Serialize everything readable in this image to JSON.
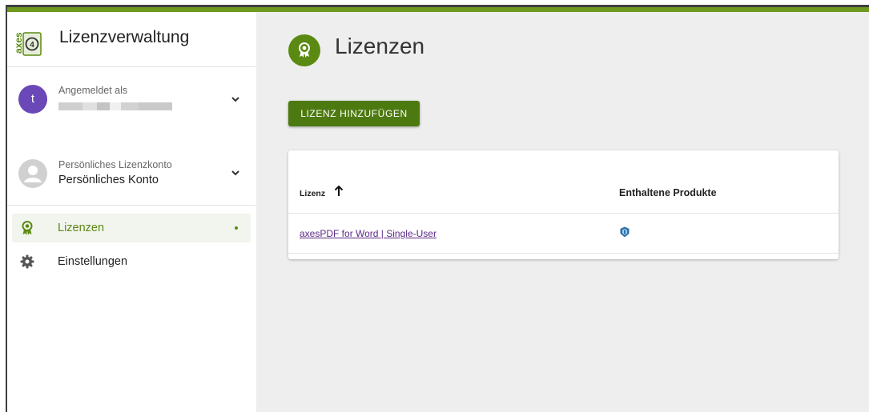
{
  "app": {
    "title": "Lizenzverwaltung",
    "brand_color": "#6f9a1e",
    "logo_text": "axes4"
  },
  "user": {
    "label": "Angemeldet als",
    "avatar_letter": "t",
    "avatar_color": "#6a48b8"
  },
  "account": {
    "label": "Persönliches Lizenzkonto",
    "name": "Persönliches Konto",
    "avatar_color": "#d0d0d0"
  },
  "nav": {
    "items": [
      {
        "label": "Lizenzen",
        "icon": "award-icon",
        "active": true
      },
      {
        "label": "Einstellungen",
        "icon": "gear-icon",
        "active": false
      }
    ]
  },
  "page": {
    "title": "Lizenzen",
    "icon": "award-icon",
    "add_button": "LIZENZ HINZUFÜGEN"
  },
  "table": {
    "columns": [
      {
        "label": "Lizenz",
        "sort": "ascending"
      },
      {
        "label": "Enthaltene Produkte"
      }
    ],
    "rows": [
      {
        "lizenz": "axesPDF for Word | Single-User",
        "product_icon": "axespdf-shield-icon"
      }
    ]
  }
}
